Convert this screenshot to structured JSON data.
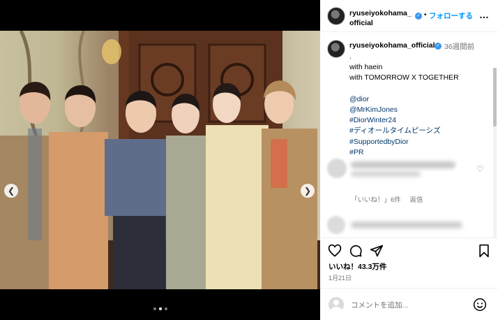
{
  "post": {
    "username_line1": "ryuseiyokohama_",
    "username_line2": "official",
    "follow_label": "フォローする",
    "separator": "•",
    "more_label": "…"
  },
  "caption": {
    "username": "ryuseiyokohama_official",
    "time_ago": "36週間前",
    "lines": [
      ".",
      "with haein",
      "with TOMORROW X TOGETHER",
      "",
      "@dior",
      "@MrKimJones",
      "#DiorWinter24",
      "#ディオールタイムピーシズ",
      "#SupportedbyDior",
      "#PR"
    ]
  },
  "comment": {
    "likes_label": "「いいね！」6件",
    "reply_label": "返信"
  },
  "stats": {
    "likes": "いいね！43.3万件",
    "date": "1月21日"
  },
  "comment_box": {
    "placeholder": "コメントを追加..."
  },
  "media": {
    "prev_icon": "chevron-left-icon",
    "next_icon": "chevron-right-icon",
    "slide_count": 3,
    "active_slide": 2
  },
  "colors": {
    "link": "#00376b",
    "accent": "#0095f6",
    "verified": "#3897f0",
    "secondary_text": "#737373"
  }
}
